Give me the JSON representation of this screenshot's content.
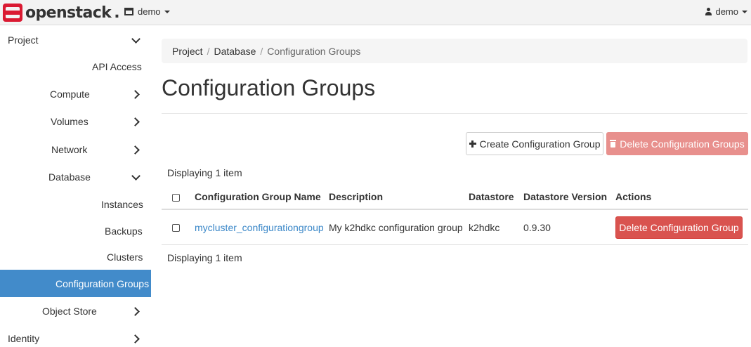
{
  "topbar": {
    "brand": "openstack",
    "project_label": "demo",
    "user_label": "demo"
  },
  "sidebar": {
    "items": [
      {
        "label": "Project"
      },
      {
        "label": "API Access"
      },
      {
        "label": "Compute"
      },
      {
        "label": "Volumes"
      },
      {
        "label": "Network"
      },
      {
        "label": "Database"
      },
      {
        "label": "Instances"
      },
      {
        "label": "Backups"
      },
      {
        "label": "Clusters"
      },
      {
        "label": "Configuration Groups"
      },
      {
        "label": "Object Store"
      },
      {
        "label": "Identity"
      }
    ]
  },
  "breadcrumb": {
    "items": [
      "Project",
      "Database",
      "Configuration Groups"
    ],
    "separator": "/"
  },
  "page": {
    "title": "Configuration Groups"
  },
  "actions": {
    "create_label": "Create Configuration Group",
    "delete_label": "Delete Configuration Groups"
  },
  "table": {
    "count_top": "Displaying 1 item",
    "count_bottom": "Displaying 1 item",
    "columns": [
      "Configuration Group Name",
      "Description",
      "Datastore",
      "Datastore Version",
      "Actions"
    ],
    "rows": [
      {
        "name": "mycluster_configurationgroup",
        "description": "My k2hdkc configuration group",
        "datastore": "k2hdkc",
        "datastore_version": "0.9.30",
        "action_label": "Delete Configuration Group"
      }
    ]
  },
  "colors": {
    "brand_red": "#da1a32",
    "active_blue": "#428bca",
    "danger": "#d9534f",
    "danger_disabled": "#e8908d",
    "link": "#3a87c8"
  }
}
